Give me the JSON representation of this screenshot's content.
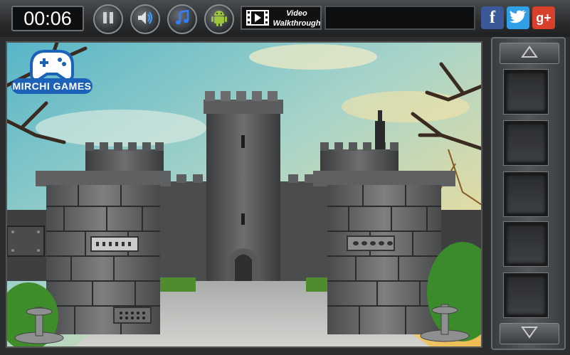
{
  "header": {
    "timer": "00:06",
    "video_button": {
      "line1": "Video",
      "line2": "Walkthrough"
    },
    "buttons": [
      {
        "name": "pause-icon"
      },
      {
        "name": "sound-icon"
      },
      {
        "name": "music-icon"
      },
      {
        "name": "android-icon"
      }
    ],
    "social": {
      "facebook": "f",
      "twitter": "t",
      "googleplus": "g+"
    },
    "colors": {
      "facebook": "#3b5998",
      "twitter": "#2fa0e8",
      "googleplus": "#d9402b"
    }
  },
  "scene": {
    "logo_text": "MIRCHI GAMES",
    "logo_color": "#1c62b8"
  },
  "inventory": {
    "slot_count": 5,
    "up_arrow": "scroll-up-icon",
    "down_arrow": "scroll-down-icon"
  }
}
